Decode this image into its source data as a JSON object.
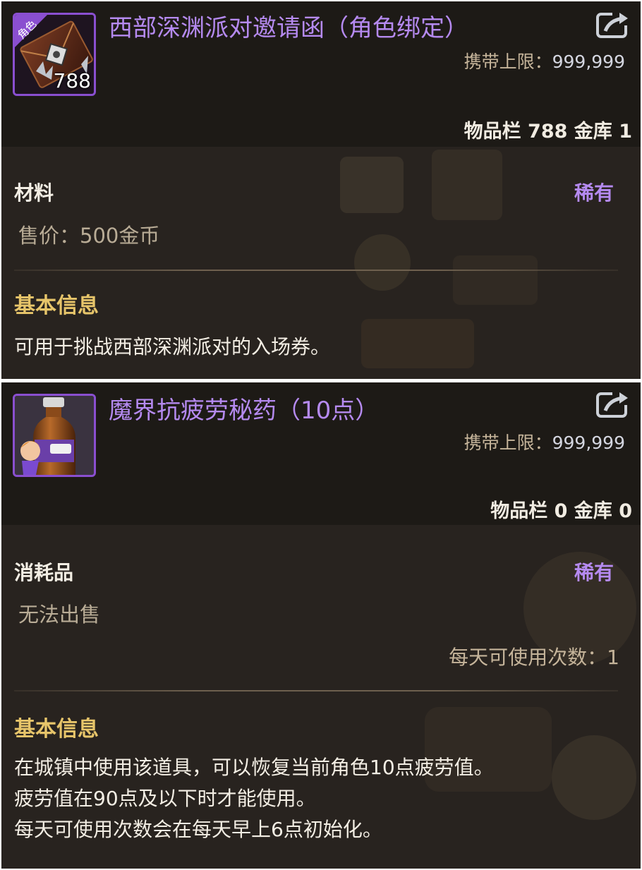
{
  "items": [
    {
      "title": "西部深渊派对邀请函（角色绑定）",
      "icon_name": "invitation-letter-icon",
      "icon_badge": "角色",
      "icon_count": "788",
      "limit_label": "携带上限：",
      "limit_value": "999,999",
      "counts": "物品栏 788 金库 1",
      "category": "材料",
      "rarity": "稀有",
      "price": "售价：500金币",
      "section_title": "基本信息",
      "description": [
        "可用于挑战西部深渊派对的入场券。"
      ]
    },
    {
      "title": "魔界抗疲劳秘药（10点）",
      "icon_name": "fatigue-potion-bottle-icon",
      "limit_label": "携带上限：",
      "limit_value": "999,999",
      "counts": "物品栏 0 金库 0",
      "category": "消耗品",
      "rarity": "稀有",
      "price": "无法出售",
      "daily_use": "每天可使用次数：1",
      "section_title": "基本信息",
      "description": [
        "在城镇中使用该道具，可以恢复当前角色10点疲劳值。",
        "疲劳值在90点及以下时才能使用。",
        "每天可使用次数会在每天早上6点初始化。"
      ]
    }
  ],
  "colors": {
    "title": "#b58af0",
    "rarity": "#b58af0",
    "section_title": "#e7c56a",
    "panel_bg": "#28231f",
    "header_bg": "#1d1a16",
    "icon_border": "#8a4fd0"
  }
}
